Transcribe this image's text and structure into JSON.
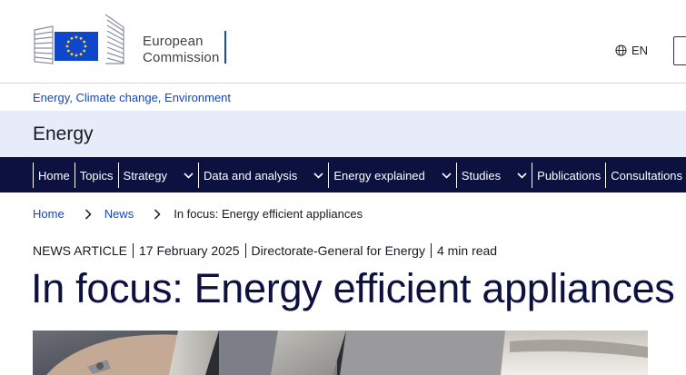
{
  "header": {
    "logo_line1": "European",
    "logo_line2": "Commission",
    "language": "EN",
    "globe_icon": "globe-icon"
  },
  "topic_links": [
    "Energy",
    "Climate change",
    "Environment"
  ],
  "site_name": "Energy",
  "nav": {
    "items": [
      {
        "label": "Home",
        "has_dropdown": false
      },
      {
        "label": "Topics",
        "has_dropdown": false
      },
      {
        "label": "Strategy",
        "has_dropdown": true
      },
      {
        "label": "Data and analysis",
        "has_dropdown": true
      },
      {
        "label": "Energy explained",
        "has_dropdown": true
      },
      {
        "label": "Studies",
        "has_dropdown": true
      },
      {
        "label": "Publications",
        "has_dropdown": false
      },
      {
        "label": "Consultations",
        "has_dropdown": false
      }
    ]
  },
  "breadcrumb": {
    "home": "Home",
    "news": "News",
    "current": "In focus: Energy efficient appliances"
  },
  "meta": {
    "type": "NEWS ARTICLE",
    "date": "17 February 2025",
    "author": "Directorate-General for Energy",
    "read_time": "4 min read"
  },
  "title": "In focus: Energy efficient appliances",
  "colors": {
    "nav_bg": "#0c1140",
    "band_bg": "#e7ecf8",
    "link": "#0e47cb",
    "flag_blue": "#0e47cb",
    "flag_stars": "#ffd617"
  }
}
